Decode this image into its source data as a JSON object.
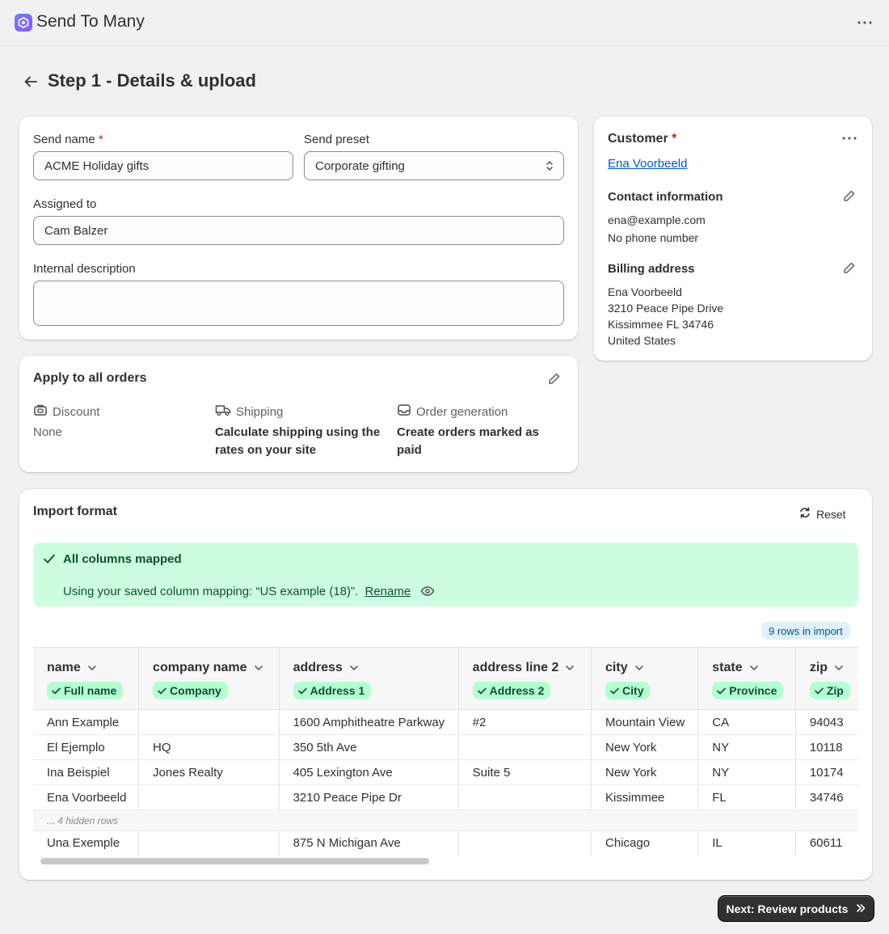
{
  "app": {
    "title": "Send To Many",
    "more_icon": "more-horizontal-icon"
  },
  "page": {
    "title": "Step 1 - Details & upload"
  },
  "details": {
    "send_name_label": "Send name",
    "send_name_value": "ACME Holiday gifts",
    "send_preset_label": "Send preset",
    "send_preset_value": "Corporate gifting",
    "assigned_label": "Assigned to",
    "assigned_value": "Cam Balzer",
    "description_label": "Internal description",
    "description_value": "",
    "required_mark": "*"
  },
  "customer": {
    "title": "Customer",
    "name": "Ena Voorbeeld",
    "contact_title": "Contact information",
    "email": "ena@example.com",
    "phone": "No phone number",
    "billing_title": "Billing address",
    "billing_lines": [
      "Ena Voorbeeld",
      "3210 Peace Pipe Drive",
      "Kissimmee FL 34746",
      "United States"
    ]
  },
  "apply_all": {
    "title": "Apply to all orders",
    "discount_label": "Discount",
    "discount_value": "None",
    "shipping_label": "Shipping",
    "shipping_value": "Calculate shipping using the rates on your site",
    "order_label": "Order generation",
    "order_value": "Create orders marked as paid"
  },
  "import": {
    "title": "Import format",
    "reset_label": "Reset",
    "banner_title": "All columns mapped",
    "banner_text": "Using your saved column mapping: “US example (18)”.",
    "banner_link": "Rename",
    "rows_badge": "9 rows in import",
    "columns": [
      {
        "header": "name",
        "tag": "Full name"
      },
      {
        "header": "company name",
        "tag": "Company"
      },
      {
        "header": "address",
        "tag": "Address 1"
      },
      {
        "header": "address line 2",
        "tag": "Address 2"
      },
      {
        "header": "city",
        "tag": "City"
      },
      {
        "header": "state",
        "tag": "Province"
      },
      {
        "header": "zip",
        "tag": "Zip"
      }
    ],
    "rows": [
      [
        "Ann Example",
        "",
        "1600 Amphitheatre Parkway",
        "#2",
        "Mountain View",
        "CA",
        "94043"
      ],
      [
        "El Ejemplo",
        "HQ",
        "350 5th Ave",
        "",
        "New York",
        "NY",
        "10118"
      ],
      [
        "Ina Beispiel",
        "Jones Realty",
        "405 Lexington Ave",
        "Suite 5",
        "New York",
        "NY",
        "10174"
      ],
      [
        "Ena Voorbeeld",
        "",
        "3210 Peace Pipe Dr",
        "",
        "Kissimmee",
        "FL",
        "34746"
      ]
    ],
    "hidden_rows": "... 4 hidden rows",
    "last_row": [
      "Una Exemple",
      "",
      "875 N Michigan Ave",
      "",
      "Chicago",
      "IL",
      "60611"
    ]
  },
  "footer": {
    "next_label": "Next: Review products"
  },
  "colors": {
    "accent": "#005bd3",
    "success_bg": "#cdfee1",
    "tag_bg": "#b4fed2",
    "primary_btn": "#303030"
  }
}
